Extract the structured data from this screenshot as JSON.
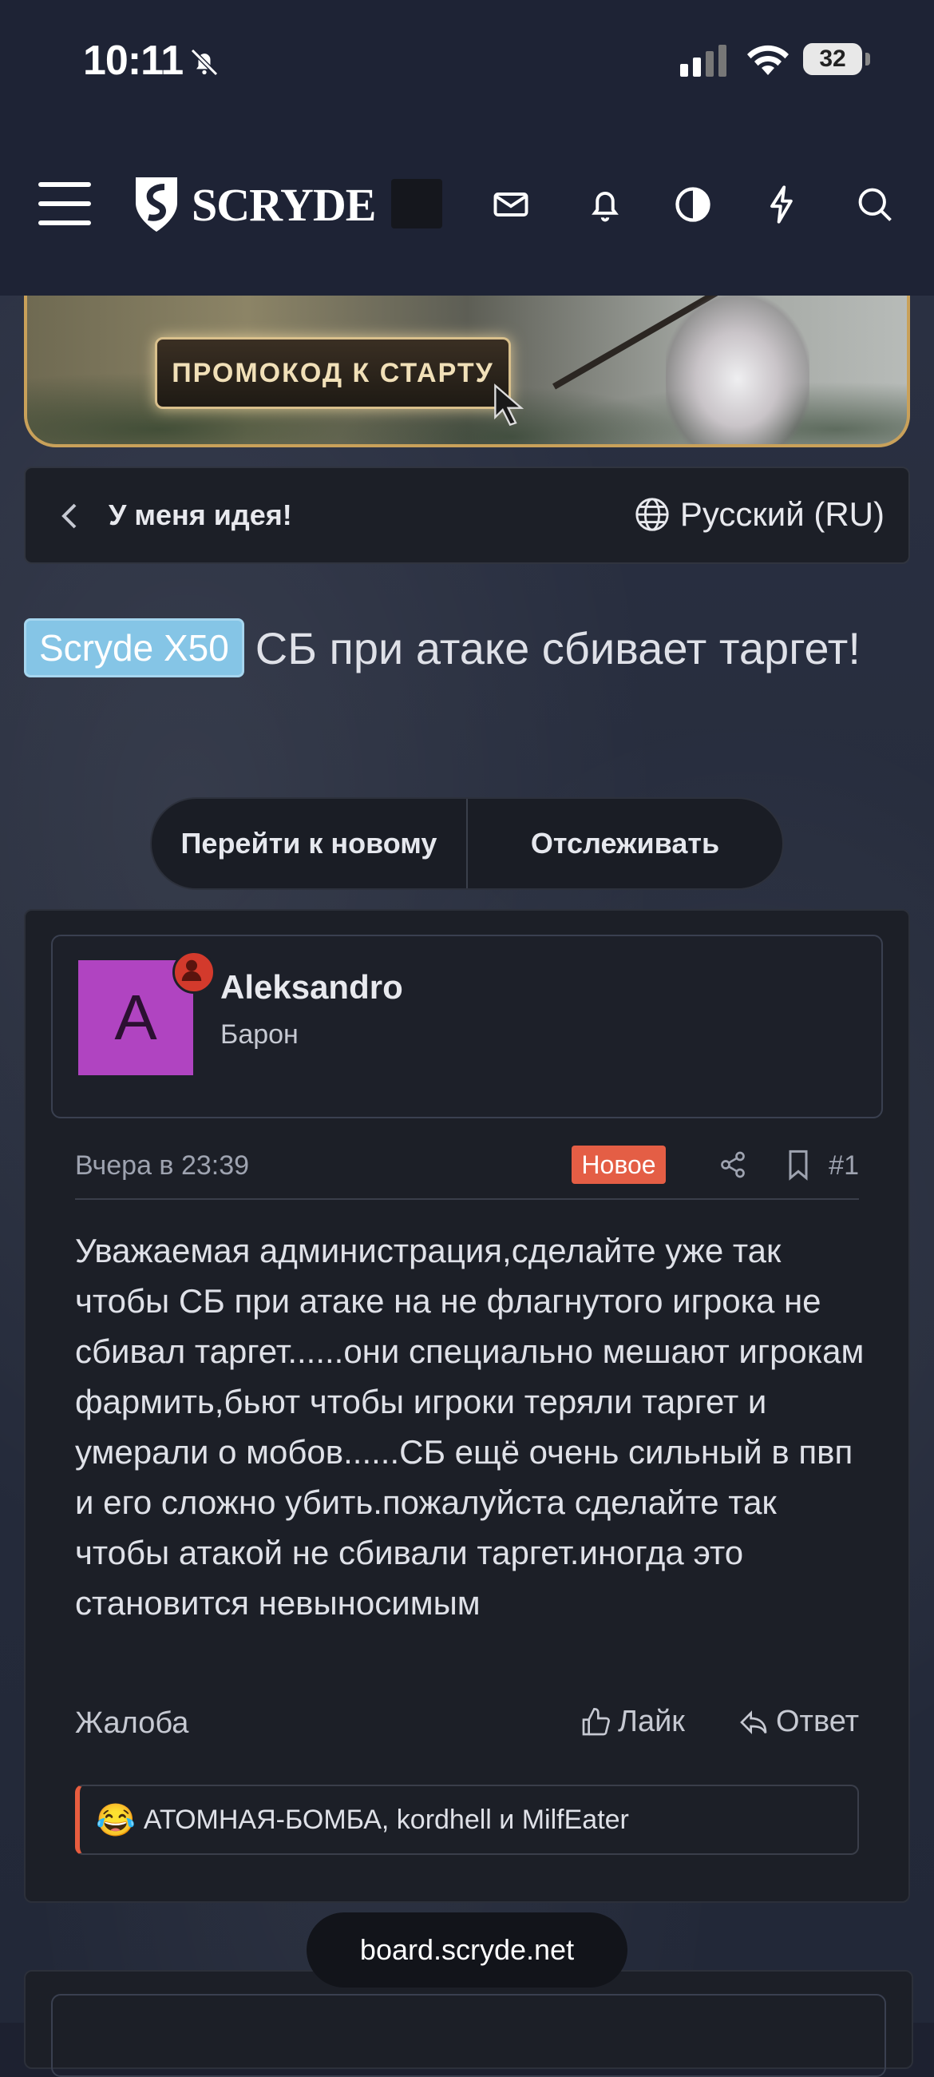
{
  "status_bar": {
    "time": "10:11",
    "battery": "32"
  },
  "header": {
    "logo_text": "SCRYDE"
  },
  "banner": {
    "promo_text": "ПРОМОКОД К СТАРТУ"
  },
  "breadcrumb": {
    "label": "У меня идея!",
    "language": "Русский (RU)"
  },
  "thread": {
    "prefix": "Scryde X50",
    "title": "СБ при атаке сбивает таргет!",
    "buttons": {
      "go_new": "Перейти к новому",
      "watch": "Отслеживать"
    }
  },
  "post": {
    "avatar_letter": "A",
    "username": "Aleksandro",
    "user_title": "Барон",
    "date": "Вчера в 23:39",
    "badge": "Новое",
    "number": "#1",
    "body": "Уважаемая администрация,сделайте уже так чтобы СБ при атаке на не флагнутого игрока не сбивал таргет......они специально мешают игрокам фармить,бьют чтобы игроки теряли таргет и умерали о мобов......СБ ещё очень сильный в пвп и его сложно убить.пожалуйста сделайте так чтобы атакой не сбивали таргет.иногда это становится невыносимым",
    "report": "Жалоба",
    "like": "Лайк",
    "reply": "Ответ",
    "reaction_emoji": "😂",
    "reactions": "АТОМНАЯ-БОМБА, kordhell и MilfEater"
  },
  "browser": {
    "url": "board.scryde.net"
  }
}
